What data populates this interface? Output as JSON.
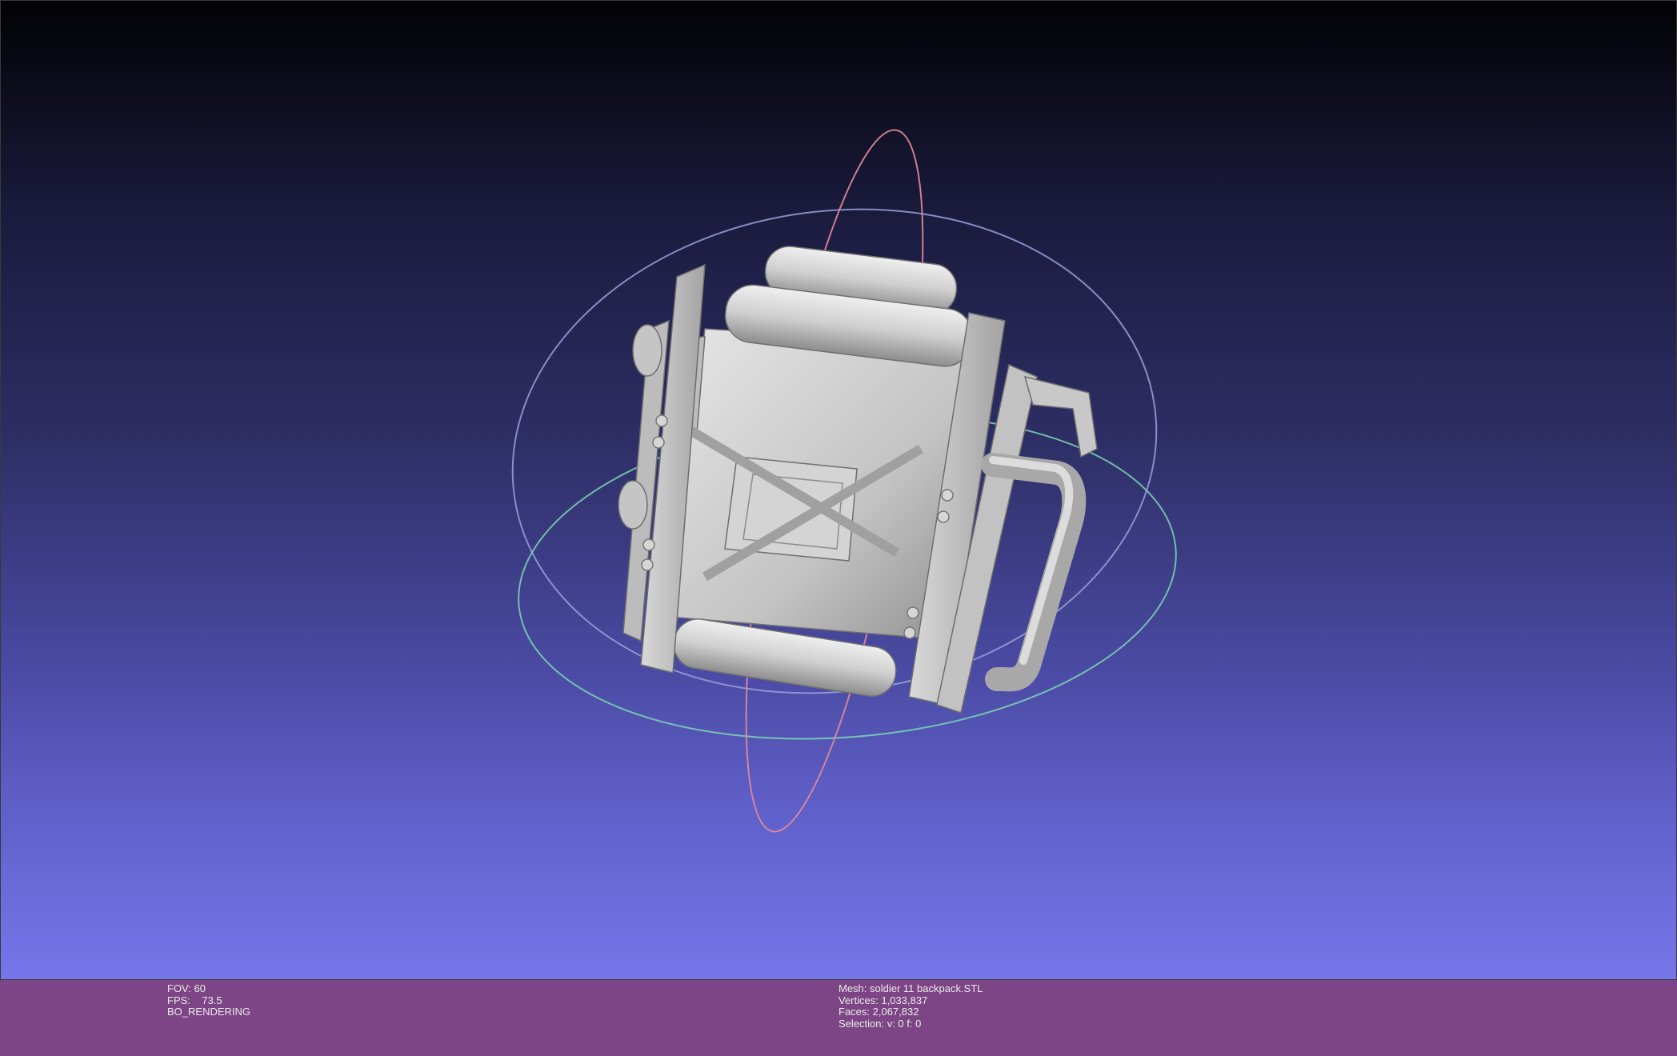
{
  "render_info": {
    "fov": "FOV: 60",
    "fps": "FPS:    73.5",
    "mode": "BO_RENDERING"
  },
  "mesh_info": {
    "mesh": "Mesh: soldier 11 backpack.STL",
    "vertices": "Vertices: 1,033,837",
    "faces": "Faces: 2,067,832",
    "selection": "Selection: v: 0 f: 0"
  },
  "colors": {
    "status_bar": "#7d4585",
    "model": "#c9c9c9",
    "trackball_x": "#e28a9a",
    "trackball_y": "#7fe0b4",
    "trackball_z": "#9aa0d8"
  }
}
